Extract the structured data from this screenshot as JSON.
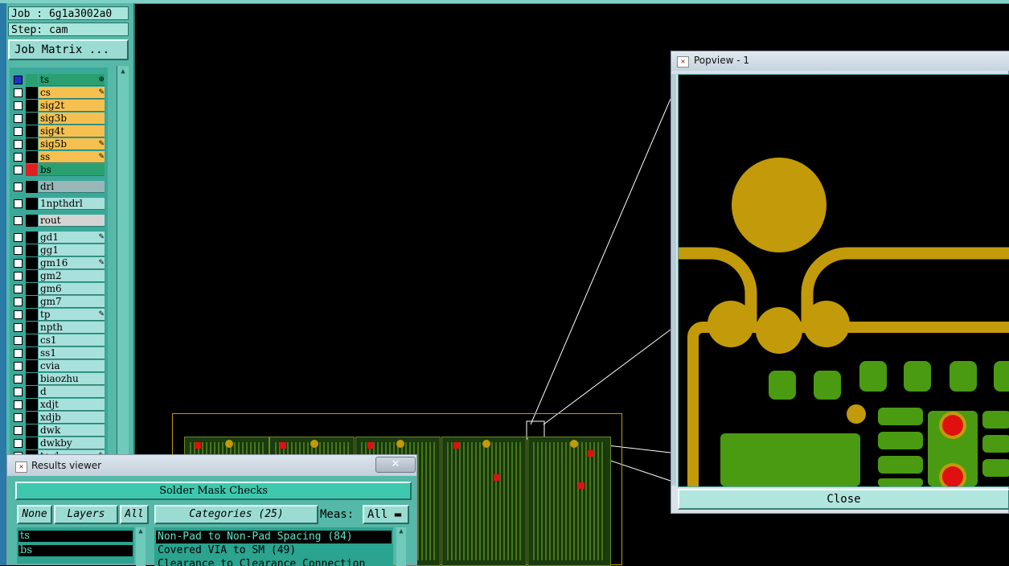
{
  "job": {
    "label": "Job : 6g1a3002a0",
    "step": "Step: cam",
    "matrix_button": "Job Matrix ..."
  },
  "layers": [
    {
      "name": "ts",
      "color": "#2aa070",
      "swatch": "#2aa070",
      "checked": true,
      "icon": "⊕"
    },
    {
      "name": "cs",
      "color": "#f5c050",
      "swatch": "#000000",
      "checked": false,
      "icon": "✎"
    },
    {
      "name": "sig2t",
      "color": "#f5c050",
      "swatch": "#000000",
      "checked": false,
      "icon": ""
    },
    {
      "name": "sig3b",
      "color": "#f5c050",
      "swatch": "#000000",
      "checked": false,
      "icon": ""
    },
    {
      "name": "sig4t",
      "color": "#f5c050",
      "swatch": "#000000",
      "checked": false,
      "icon": ""
    },
    {
      "name": "sig5b",
      "color": "#f5c050",
      "swatch": "#000000",
      "checked": false,
      "icon": "✎"
    },
    {
      "name": "ss",
      "color": "#f5c050",
      "swatch": "#000000",
      "checked": false,
      "icon": "✎"
    },
    {
      "name": "bs",
      "color": "#2aa070",
      "swatch": "#e02020",
      "checked": false,
      "icon": ""
    },
    {
      "name": "drl",
      "color": "#9ab6b8",
      "swatch": "#000000",
      "checked": false,
      "icon": ""
    },
    {
      "name": "1npthdrl",
      "color": "#a8e0dc",
      "swatch": "#000000",
      "checked": false,
      "icon": ""
    },
    {
      "name": "rout",
      "color": "#d4d4d4",
      "swatch": "#000000",
      "checked": false,
      "icon": ""
    },
    {
      "name": "gd1",
      "color": "#a8e0dc",
      "swatch": "#000000",
      "checked": false,
      "icon": "✎"
    },
    {
      "name": "gg1",
      "color": "#a8e0dc",
      "swatch": "#000000",
      "checked": false,
      "icon": ""
    },
    {
      "name": "gm16",
      "color": "#a8e0dc",
      "swatch": "#000000",
      "checked": false,
      "icon": "✎"
    },
    {
      "name": "gm2",
      "color": "#a8e0dc",
      "swatch": "#000000",
      "checked": false,
      "icon": ""
    },
    {
      "name": "gm6",
      "color": "#a8e0dc",
      "swatch": "#000000",
      "checked": false,
      "icon": ""
    },
    {
      "name": "gm7",
      "color": "#a8e0dc",
      "swatch": "#000000",
      "checked": false,
      "icon": ""
    },
    {
      "name": "tp",
      "color": "#a8e0dc",
      "swatch": "#000000",
      "checked": false,
      "icon": "✎"
    },
    {
      "name": "npth",
      "color": "#a8e0dc",
      "swatch": "#000000",
      "checked": false,
      "icon": ""
    },
    {
      "name": "cs1",
      "color": "#a8e0dc",
      "swatch": "#000000",
      "checked": false,
      "icon": ""
    },
    {
      "name": "ss1",
      "color": "#a8e0dc",
      "swatch": "#000000",
      "checked": false,
      "icon": ""
    },
    {
      "name": "cvia",
      "color": "#a8e0dc",
      "swatch": "#000000",
      "checked": false,
      "icon": ""
    },
    {
      "name": "biaozhu",
      "color": "#a8e0dc",
      "swatch": "#000000",
      "checked": false,
      "icon": ""
    },
    {
      "name": "d",
      "color": "#a8e0dc",
      "swatch": "#000000",
      "checked": false,
      "icon": ""
    },
    {
      "name": "xdjt",
      "color": "#a8e0dc",
      "swatch": "#000000",
      "checked": false,
      "icon": ""
    },
    {
      "name": "xdjb",
      "color": "#a8e0dc",
      "swatch": "#000000",
      "checked": false,
      "icon": ""
    },
    {
      "name": "dwk",
      "color": "#a8e0dc",
      "swatch": "#000000",
      "checked": false,
      "icon": ""
    },
    {
      "name": "dwkby",
      "color": "#a8e0dc",
      "swatch": "#000000",
      "checked": false,
      "icon": ""
    },
    {
      "name": "to.d",
      "color": "#a8e0dc",
      "swatch": "#000000",
      "checked": false,
      "icon": "✎"
    }
  ],
  "popview": {
    "title": "Popview - 1",
    "close_label": "Close"
  },
  "results": {
    "title": "Results viewer",
    "close_glyph": "✕",
    "heading": "Solder Mask Checks",
    "none_label": "None",
    "layers_label": "Layers",
    "all_label": "All",
    "categories_label": "Categories (25)",
    "meas_label": "Meas:",
    "meas_value": "All",
    "layer_items": [
      "ts",
      "bs"
    ],
    "categories": [
      "Non-Pad to Non-Pad Spacing (84)",
      "Covered VIA to SM (49)",
      "Clearance to Clearance Connection"
    ]
  },
  "colors": {
    "trace": "#c29a0a",
    "pad": "#4a9a12",
    "violation": "#e01010"
  }
}
